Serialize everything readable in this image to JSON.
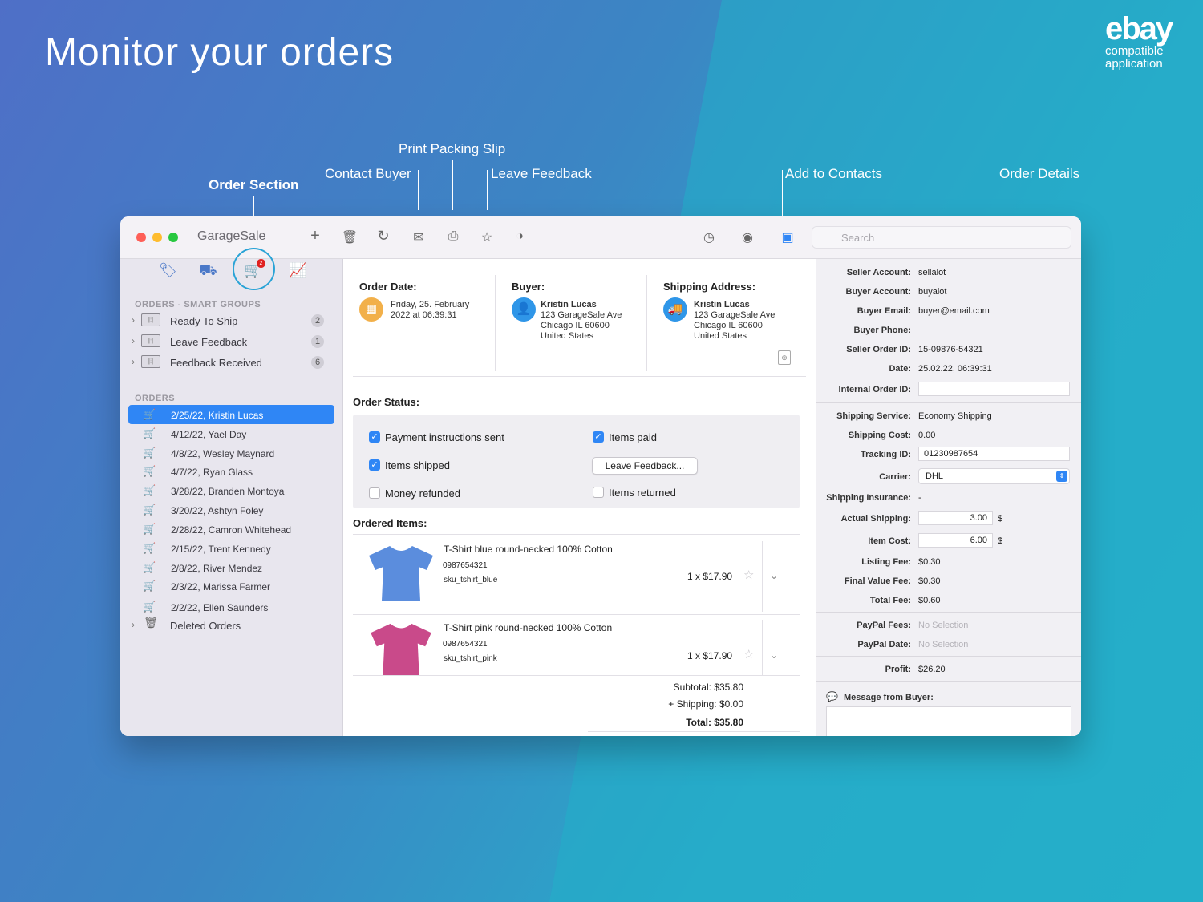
{
  "headline": "Monitor your orders",
  "brand": {
    "logo": "ebay",
    "line1": "compatible",
    "line2": "application"
  },
  "callouts": {
    "order_section": "Order Section",
    "contact_buyer": "Contact Buyer",
    "print_packing_slip": "Print Packing Slip",
    "leave_feedback": "Leave Feedback",
    "add_to_contacts": "Add to Contacts",
    "order_details": "Order Details"
  },
  "window": {
    "app_title": "GarageSale",
    "search_placeholder": "Search",
    "toolbar_icons": [
      "plus-icon",
      "trash-icon",
      "refresh-icon",
      "mail-icon",
      "printer-icon",
      "star-icon",
      "toggle-icon",
      "clock-icon",
      "person-icon",
      "sidebar-icon"
    ]
  },
  "sidebar": {
    "order_badge": "2",
    "smart_groups_header": "ORDERS - SMART GROUPS",
    "smart_groups": [
      {
        "label": "Ready To Ship",
        "count": "2"
      },
      {
        "label": "Leave Feedback",
        "count": "1"
      },
      {
        "label": "Feedback Received",
        "count": "6"
      }
    ],
    "orders_header": "ORDERS",
    "orders": [
      "2/25/22, Kristin Lucas",
      "4/12/22, Yael Day",
      "4/8/22, Wesley Maynard",
      "4/7/22, Ryan Glass",
      "3/28/22, Branden Montoya",
      "3/20/22, Ashtyn Foley",
      "2/28/22, Camron Whitehead",
      "2/15/22, Trent Kennedy",
      "2/8/22, River Mendez",
      "2/3/22, Marissa Farmer",
      "2/2/22, Ellen Saunders"
    ],
    "deleted": "Deleted Orders"
  },
  "order": {
    "date_label": "Order Date:",
    "date_line1": "Friday, 25. February",
    "date_line2": "2022 at 06:39:31",
    "buyer_label": "Buyer:",
    "buyer": {
      "name": "Kristin Lucas",
      "street": "123 GarageSale Ave",
      "city": "Chicago IL 60600",
      "country": "United States"
    },
    "ship_label": "Shipping Address:",
    "ship": {
      "name": "Kristin Lucas",
      "street": "123 GarageSale Ave",
      "city": "Chicago IL 60600",
      "country": "United States"
    },
    "status_label": "Order Status:",
    "status": {
      "payment_sent": "Payment instructions sent",
      "items_paid": "Items paid",
      "items_shipped": "Items shipped",
      "leave_feedback_btn": "Leave Feedback...",
      "money_refunded": "Money refunded",
      "items_returned": "Items returned"
    },
    "items_label": "Ordered Items:",
    "items": [
      {
        "title": "T-Shirt blue round-necked 100% Cotton",
        "code": "0987654321",
        "sku": "sku_tshirt_blue",
        "price": "1 x $17.90",
        "color": "#5b8ddd"
      },
      {
        "title": "T-Shirt pink round-necked 100% Cotton",
        "code": "0987654321",
        "sku": "sku_tshirt_pink",
        "price": "1 x $17.90",
        "color": "#c94a8a"
      }
    ],
    "subtotal": "Subtotal: $35.80",
    "shipping": "+ Shipping: $0.00",
    "total": "Total: $35.80"
  },
  "details": {
    "seller_account_label": "Seller Account:",
    "seller_account": "sellalot",
    "buyer_account_label": "Buyer Account:",
    "buyer_account": "buyalot",
    "buyer_email_label": "Buyer Email:",
    "buyer_email": "buyer@email.com",
    "buyer_phone_label": "Buyer Phone:",
    "seller_order_id_label": "Seller Order ID:",
    "seller_order_id": "15-09876-54321",
    "date_label": "Date:",
    "date": "25.02.22, 06:39:31",
    "internal_order_id_label": "Internal Order ID:",
    "shipping_service_label": "Shipping Service:",
    "shipping_service": "Economy Shipping",
    "shipping_cost_label": "Shipping Cost:",
    "shipping_cost": "0.00",
    "tracking_id_label": "Tracking ID:",
    "tracking_id": "01230987654",
    "carrier_label": "Carrier:",
    "carrier": "DHL",
    "shipping_insurance_label": "Shipping Insurance:",
    "shipping_insurance": "-",
    "actual_shipping_label": "Actual Shipping:",
    "actual_shipping": "3.00",
    "item_cost_label": "Item Cost:",
    "item_cost": "6.00",
    "currency": "$",
    "listing_fee_label": "Listing Fee:",
    "listing_fee": "$0.30",
    "final_value_fee_label": "Final Value Fee:",
    "final_value_fee": "$0.30",
    "total_fee_label": "Total Fee:",
    "total_fee": "$0.60",
    "paypal_fees_label": "PayPal Fees:",
    "paypal_fees": "No Selection",
    "paypal_date_label": "PayPal Date:",
    "paypal_date": "No Selection",
    "profit_label": "Profit:",
    "profit": "$26.20",
    "message_label": "Message from Buyer:"
  }
}
